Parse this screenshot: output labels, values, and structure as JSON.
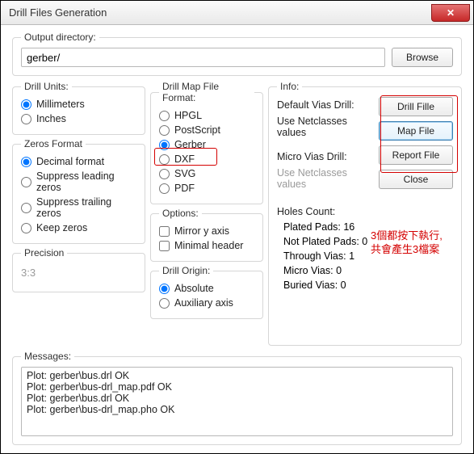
{
  "window": {
    "title": "Drill Files Generation"
  },
  "output": {
    "legend": "Output directory:",
    "value": "gerber/",
    "browse": "Browse"
  },
  "drillUnits": {
    "legend": "Drill Units:",
    "options": [
      "Millimeters",
      "Inches"
    ],
    "selected": "Millimeters"
  },
  "zerosFormat": {
    "legend": "Zeros Format",
    "options": [
      "Decimal format",
      "Suppress leading zeros",
      "Suppress trailing zeros",
      "Keep zeros"
    ],
    "selected": "Decimal format"
  },
  "precision": {
    "legend": "Precision",
    "value": "3:3"
  },
  "mapFormat": {
    "legend": "Drill Map File Format:",
    "options": [
      "HPGL",
      "PostScript",
      "Gerber",
      "DXF",
      "SVG",
      "PDF"
    ],
    "selected": "Gerber"
  },
  "options": {
    "legend": "Options:",
    "items": [
      {
        "label": "Mirror y axis",
        "checked": false
      },
      {
        "label": "Minimal header",
        "checked": false
      }
    ]
  },
  "drillOrigin": {
    "legend": "Drill Origin:",
    "options": [
      "Absolute",
      "Auxiliary axis"
    ],
    "selected": "Absolute"
  },
  "info": {
    "legend": "Info:",
    "defaultViasDrill": "Default Vias Drill:",
    "useNetclasses1": "Use Netclasses values",
    "microViasDrill": "Micro Vias Drill:",
    "useNetclasses2": "Use Netclasses values",
    "holesCountHdr": "Holes Count:",
    "holes": {
      "platedPads": "Plated Pads: 16",
      "notPlatedPads": "Not Plated Pads: 0",
      "throughVias": "Through Vias: 1",
      "microVias": "Micro Vias: 0",
      "buriedVias": "Buried Vias: 0"
    },
    "buttons": {
      "drillFile": "Drill Fille",
      "mapFile": "Map File",
      "reportFile": "Report File",
      "close": "Close"
    }
  },
  "annotation": {
    "line1": "3個都按下執行,",
    "line2": "共會產生3檔案"
  },
  "messages": {
    "legend": "Messages:",
    "lines": [
      "Plot: gerber\\bus.drl OK",
      "Plot: gerber\\bus-drl_map.pdf OK",
      "Plot: gerber\\bus.drl OK",
      "Plot: gerber\\bus-drl_map.pho OK"
    ]
  }
}
